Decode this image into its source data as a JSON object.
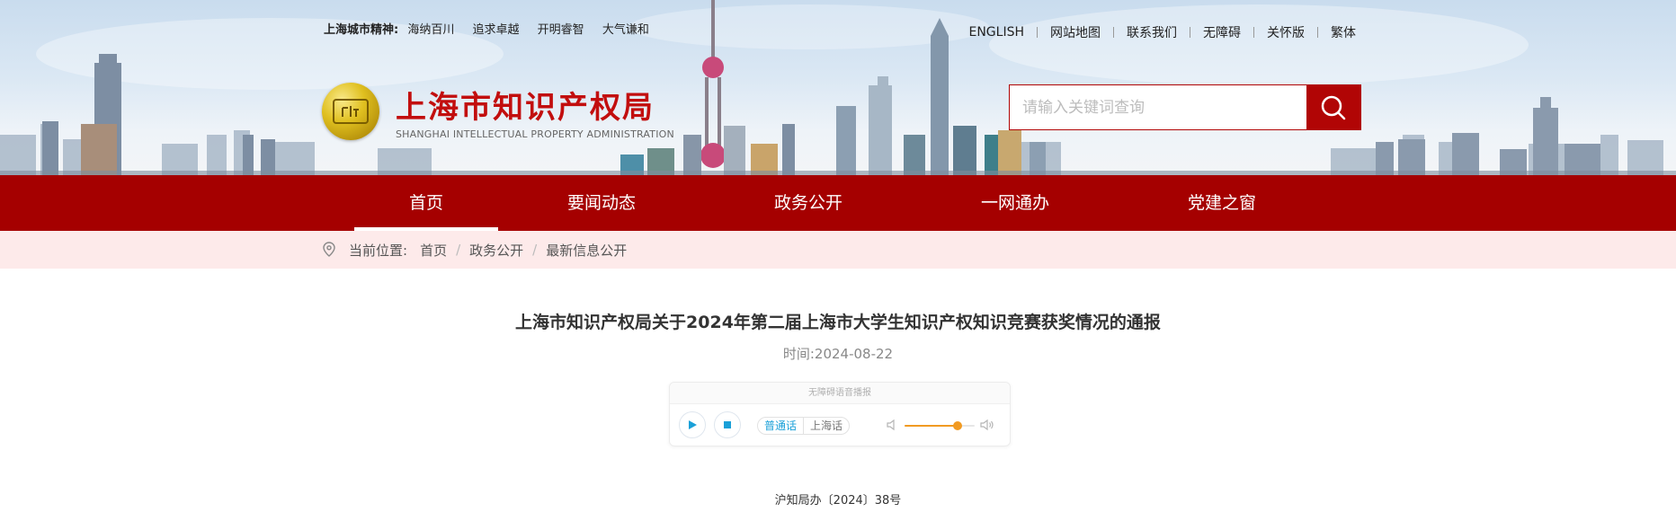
{
  "colors": {
    "brand_red": "#a50000",
    "title_red": "#c20e0e",
    "breadcrumb_bg": "#fdeaea",
    "accent_blue": "#1aa0d8",
    "volume_orange": "#f19a22"
  },
  "header": {
    "spirit_label": "上海城市精神:",
    "spirit_items": [
      "海纳百川",
      "追求卓越",
      "开明睿智",
      "大气谦和"
    ],
    "top_links": [
      "ENGLISH",
      "网站地图",
      "联系我们",
      "无障碍",
      "关怀版",
      "繁体"
    ],
    "site_title": "上海市知识产权局",
    "site_subtitle": "SHANGHAI INTELLECTUAL PROPERTY ADMINISTRATION",
    "search_placeholder": "请输入关键词查询",
    "search_icon": "search-icon"
  },
  "nav": {
    "items": [
      "首页",
      "要闻动态",
      "政务公开",
      "一网通办",
      "党建之窗"
    ],
    "active_index": 0
  },
  "breadcrumb": {
    "label": "当前位置:",
    "items": [
      "首页",
      "政务公开",
      "最新信息公开"
    ]
  },
  "article": {
    "title": "上海市知识产权局关于2024年第二届上海市大学生知识产权知识竞赛获奖情况的通报",
    "time": "时间:2024-08-22",
    "doc_number": "沪知局办〔2024〕38号"
  },
  "player": {
    "header": "无障碍语音播报",
    "dialects": [
      "普通话",
      "上海话"
    ],
    "selected_dialect": "普通话",
    "volume": 0.75
  }
}
